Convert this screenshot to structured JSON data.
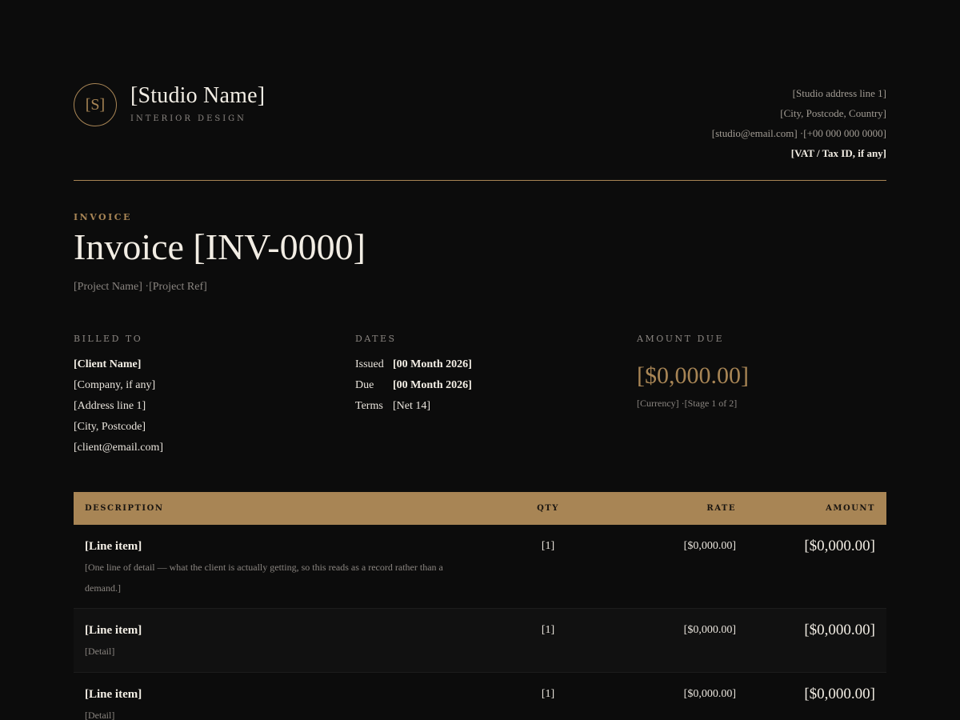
{
  "studio": {
    "logo_initial": "[S]",
    "name": "[Studio Name]",
    "tagline": "INTERIOR DESIGN",
    "address_line1": "[Studio address line 1]",
    "address_line2": "[City, Postcode, Country]",
    "contact": "[studio@email.com] ·[+00 000 000 0000]",
    "tax_id": "[VAT / Tax ID, if any]"
  },
  "document": {
    "label": "INVOICE",
    "title": "Invoice [INV-0000]",
    "subtitle": "[Project Name] ·[Project Ref]"
  },
  "billed_to": {
    "heading": "BILLED TO",
    "client_name": "[Client Name]",
    "company": "[Company, if any]",
    "address_line1": "[Address line 1]",
    "city": "[City, Postcode]",
    "email": "[client@email.com]"
  },
  "dates": {
    "heading": "DATES",
    "issued_label": "Issued",
    "issued_value": "[00 Month 2026]",
    "due_label": "Due",
    "due_value": "[00 Month 2026]",
    "terms_label": "Terms",
    "terms_value": "[Net 14]"
  },
  "amount_due": {
    "heading": "AMOUNT DUE",
    "value": "[$0,000.00]",
    "meta": "[Currency] ·[Stage 1 of 2]"
  },
  "table": {
    "headers": {
      "description": "DESCRIPTION",
      "qty": "QTY",
      "rate": "RATE",
      "amount": "AMOUNT"
    },
    "rows": [
      {
        "name": "[Line item]",
        "detail": "[One line of detail — what the client is actually getting, so this reads as a record rather than a demand.]",
        "qty": "[1]",
        "rate": "[$0,000.00]",
        "amount": "[$0,000.00]"
      },
      {
        "name": "[Line item]",
        "detail": "[Detail]",
        "qty": "[1]",
        "rate": "[$0,000.00]",
        "amount": "[$0,000.00]"
      },
      {
        "name": "[Line item]",
        "detail": "[Detail]",
        "qty": "[1]",
        "rate": "[$0,000.00]",
        "amount": "[$0,000.00]"
      }
    ]
  },
  "colors": {
    "accent": "#a88555",
    "background": "#0c0c0c",
    "text": "#e9e4dc",
    "muted": "#8a8580"
  }
}
